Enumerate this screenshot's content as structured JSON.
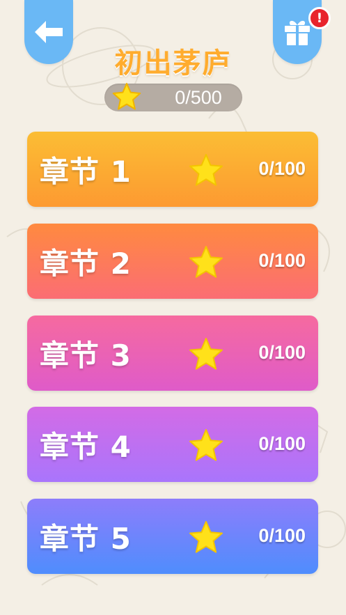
{
  "header": {
    "title": "初出茅庐",
    "total_score": "0/500",
    "notification": "!"
  },
  "icons": {
    "back": "arrow-left-icon",
    "gift": "gift-icon",
    "star": "star-icon"
  },
  "colors": {
    "tab_blue": "#6ab8f5",
    "title_orange": "#ffac2e",
    "badge_red": "#e8242c",
    "star_yellow": "#ffe11a"
  },
  "chapters": [
    {
      "label": "章节 1",
      "score": "0/100",
      "gradient": [
        "#fbbd34",
        "#fd9a31"
      ]
    },
    {
      "label": "章节 2",
      "score": "0/100",
      "gradient": [
        "#ff8a3f",
        "#fb6d74"
      ]
    },
    {
      "label": "章节 3",
      "score": "0/100",
      "gradient": [
        "#f66a9f",
        "#df5bc9"
      ]
    },
    {
      "label": "章节 4",
      "score": "0/100",
      "gradient": [
        "#d36be6",
        "#a975fc"
      ]
    },
    {
      "label": "章节 5",
      "score": "0/100",
      "gradient": [
        "#8d7dfb",
        "#4f8dfd"
      ]
    }
  ]
}
